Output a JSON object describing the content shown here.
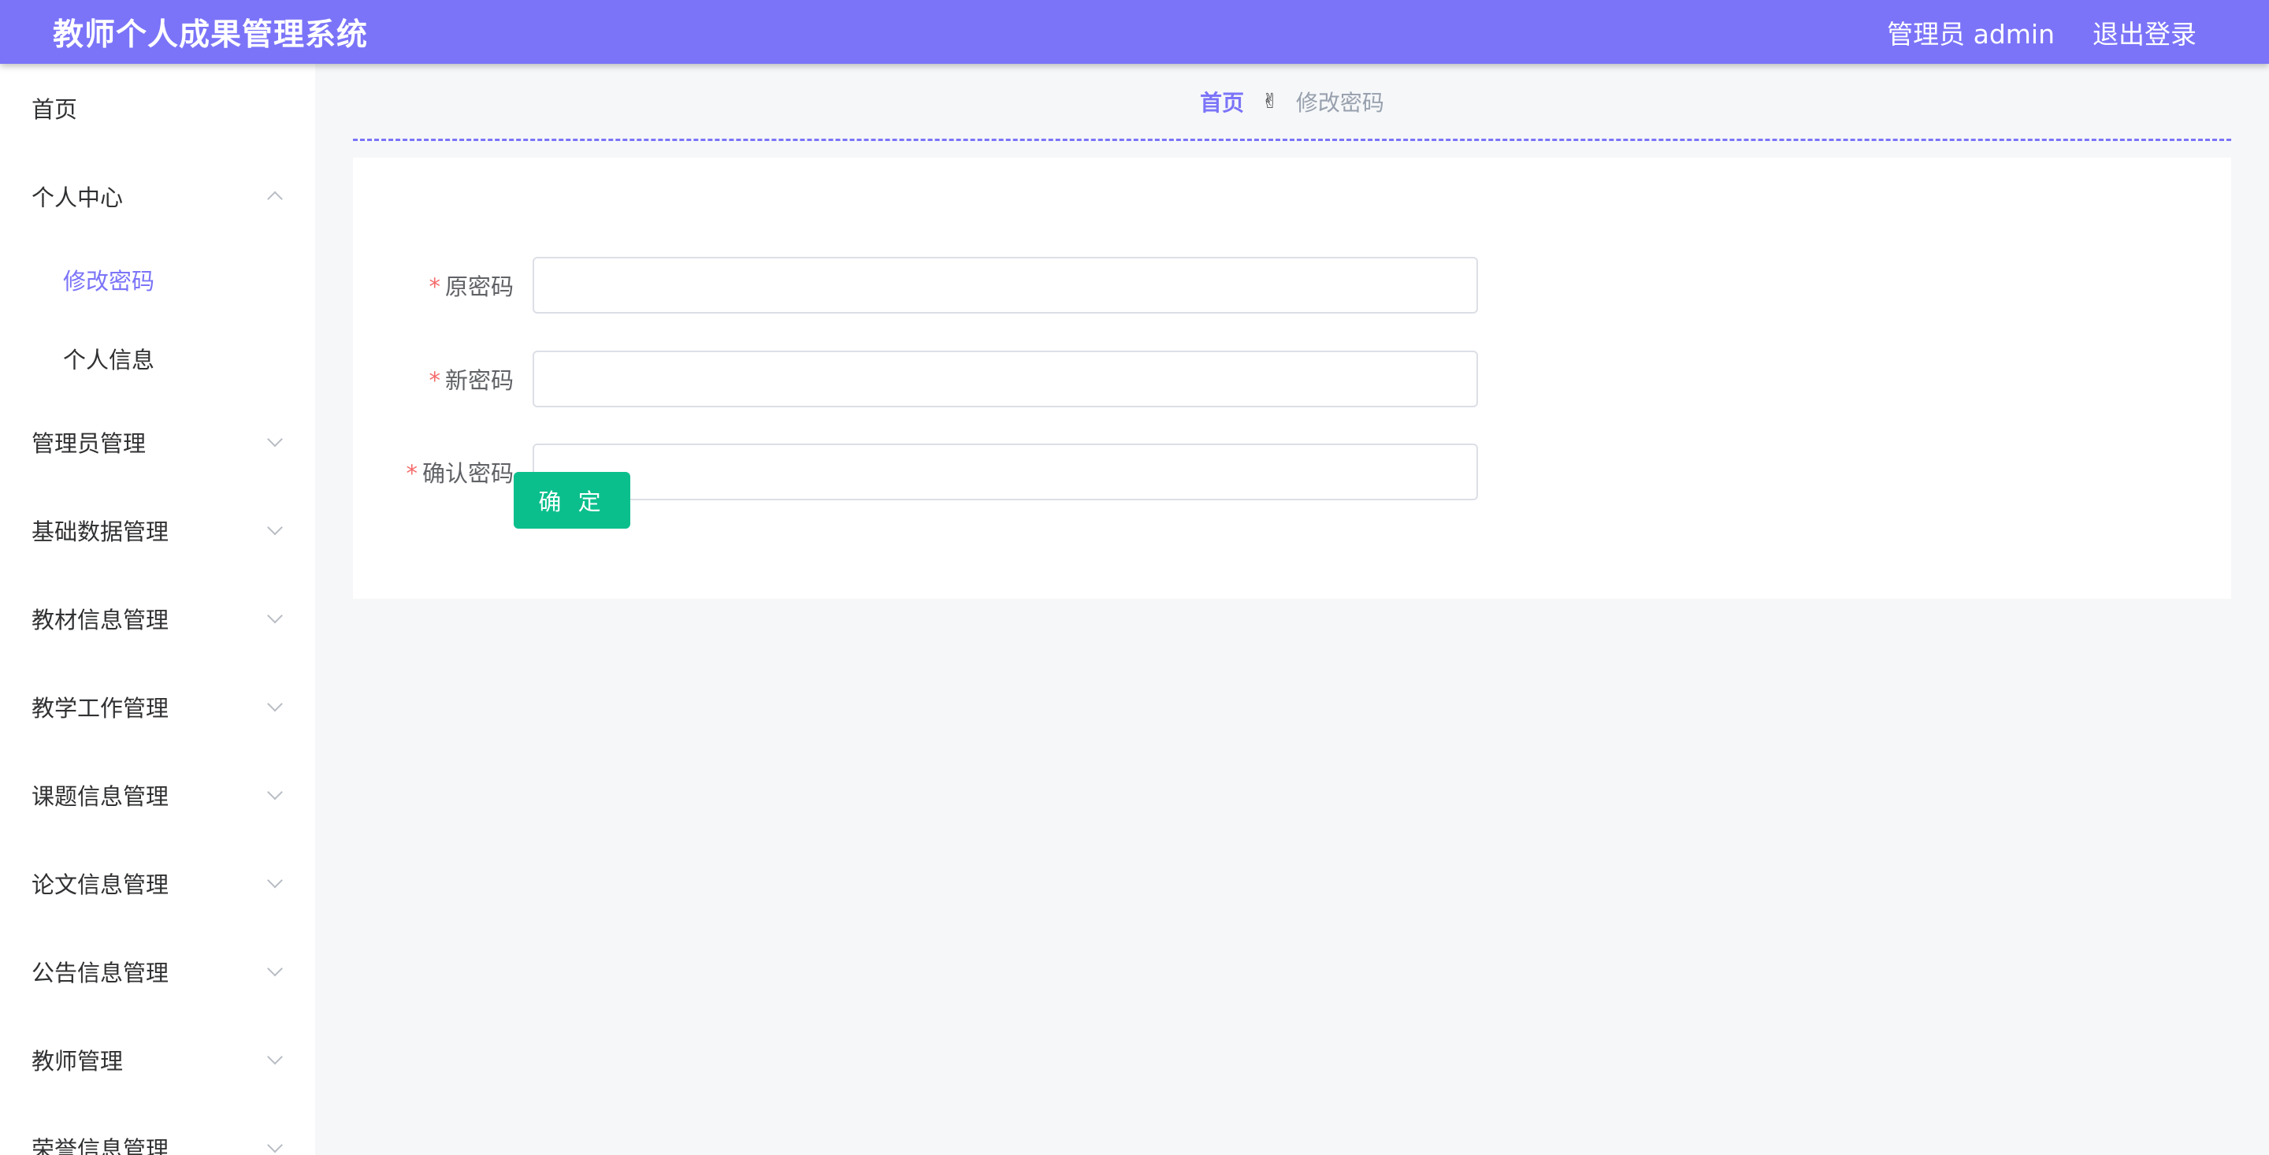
{
  "header": {
    "title": "教师个人成果管理系统",
    "user": "管理员 admin",
    "logout": "退出登录"
  },
  "sidebar": {
    "home": "首页",
    "personal_center": "个人中心",
    "sub_items": [
      "修改密码",
      "个人信息"
    ],
    "groups": [
      "管理员管理",
      "基础数据管理",
      "教材信息管理",
      "教学工作管理",
      "课题信息管理",
      "论文信息管理",
      "公告信息管理",
      "教师管理",
      "荣誉信息管理"
    ]
  },
  "breadcrumb": {
    "home": "首页",
    "separator": "✌",
    "current": "修改密码"
  },
  "form": {
    "fields": [
      {
        "required_mark": "*",
        "label": "原密码",
        "value": ""
      },
      {
        "required_mark": "*",
        "label": "新密码",
        "value": ""
      },
      {
        "required_mark": "*",
        "label": "确认密码",
        "value": ""
      }
    ],
    "submit_label": "确 定"
  },
  "colors": {
    "accent": "#7b74f8",
    "submit": "#0bbf8d",
    "required": "#f56c6c"
  }
}
